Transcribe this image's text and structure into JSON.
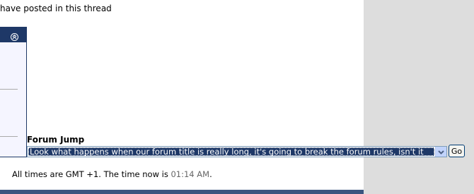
{
  "thread": {
    "posted_note": "have posted in this thread"
  },
  "forum_jump": {
    "label": "Forum Jump",
    "selected_option": "Look what happens when our forum title is really long, it's going to break the forum rules, isn't it",
    "go_label": "Go"
  },
  "footer": {
    "time_prefix": "All times are GMT +1. The time now is ",
    "time_value": "01:14 AM",
    "time_suffix": "."
  },
  "icons": {
    "collapse": "collapse-up-icon",
    "dropdown": "chevron-down-icon"
  },
  "colors": {
    "header_blue": "#1e3867",
    "side_panel": "#dddddd",
    "bottom_bar": "#3a5580"
  }
}
